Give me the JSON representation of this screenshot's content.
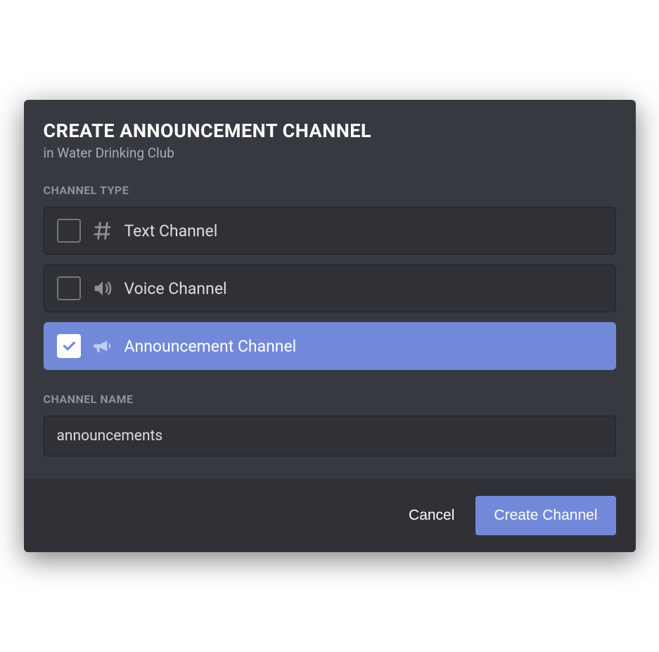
{
  "modal": {
    "title": "CREATE ANNOUNCEMENT CHANNEL",
    "subtitle": "in Water Drinking Club"
  },
  "channelType": {
    "label": "CHANNEL TYPE",
    "options": [
      {
        "label": "Text Channel",
        "selected": false,
        "icon": "hash-icon"
      },
      {
        "label": "Voice Channel",
        "selected": false,
        "icon": "speaker-icon"
      },
      {
        "label": "Announcement Channel",
        "selected": true,
        "icon": "megaphone-icon"
      }
    ]
  },
  "channelName": {
    "label": "CHANNEL NAME",
    "value": "announcements"
  },
  "footer": {
    "cancel": "Cancel",
    "create": "Create Channel"
  },
  "colors": {
    "accent": "#7289da",
    "background": "#36393f",
    "backgroundDark": "#2f3136"
  }
}
